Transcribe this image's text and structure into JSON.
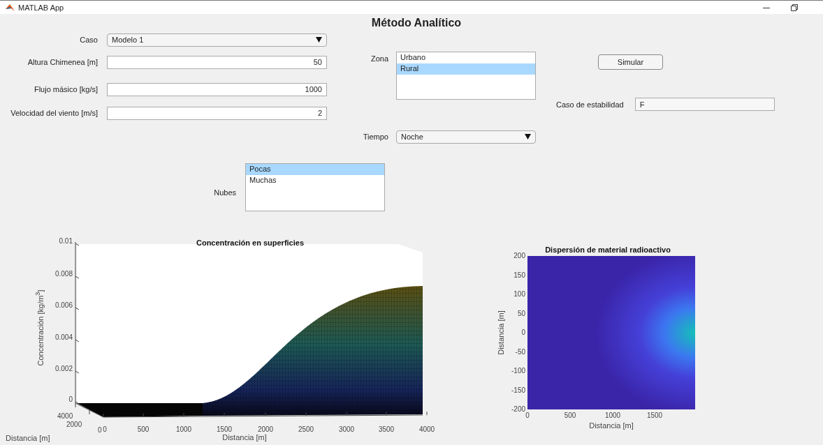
{
  "window": {
    "title": "MATLAB App"
  },
  "heading": "Método Analítico",
  "inputs": [
    {
      "kind": "dropdown",
      "label": "Caso",
      "value": "Modelo 1"
    },
    {
      "kind": "numeric",
      "label": "Altura Chimenea [m]",
      "value": "50"
    },
    {
      "kind": "numeric",
      "label": "Flujo másico [kg/s]",
      "value": "1000"
    },
    {
      "kind": "numeric",
      "label": "Velocidad del viento [m/s]",
      "value": "2"
    }
  ],
  "zona": {
    "label": "Zona",
    "items": [
      {
        "label": "Urbano",
        "selected": false
      },
      {
        "label": "Rural",
        "selected": true
      }
    ]
  },
  "tiempo": {
    "label": "Tiempo",
    "value": "Noche"
  },
  "nubes": {
    "label": "Nubes",
    "items": [
      {
        "label": "Pocas",
        "selected": true
      },
      {
        "label": "Muchas",
        "selected": false
      }
    ]
  },
  "simulate_button": "Simular",
  "stability": {
    "label": "Caso de estabilidad",
    "value": "F"
  },
  "surface_chart": {
    "title": "Concentración en superficies",
    "z_label": "Concentración  [kg/m$^{3}$]",
    "z_ticks": [
      "0.01",
      "0.008",
      "0.006",
      "0.004",
      "0.002",
      "0"
    ],
    "x_label": "Distancia [m]",
    "x_ticks": [
      "0",
      "500",
      "1000",
      "1500",
      "2000",
      "2500",
      "3000",
      "3500",
      "4000"
    ],
    "y_label": "Distancia [m]",
    "y_ticks": [
      "4000",
      "2000",
      "0"
    ]
  },
  "heatmap_chart": {
    "title": "Dispersión de material radioactivo",
    "y_label": "Distancia [m]",
    "y_ticks": [
      "200",
      "150",
      "100",
      "50",
      "0",
      "-50",
      "-100",
      "-150",
      "-200"
    ],
    "x_label": "Distancia [m]",
    "x_ticks": [
      "0",
      "500",
      "1000",
      "1500"
    ]
  }
}
